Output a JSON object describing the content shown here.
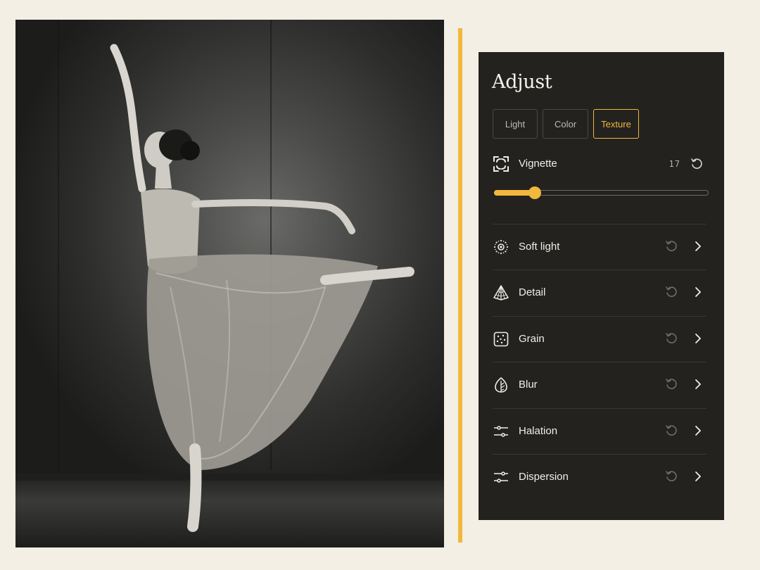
{
  "panel": {
    "title": "Adjust",
    "tabs": [
      {
        "label": "Light",
        "active": false
      },
      {
        "label": "Color",
        "active": false
      },
      {
        "label": "Texture",
        "active": true
      }
    ],
    "vignette": {
      "label": "Vignette",
      "value": "17",
      "slider_fraction": 0.19,
      "icon": "vignette-frame-icon"
    },
    "items": [
      {
        "label": "Soft light",
        "icon": "soft-light-icon"
      },
      {
        "label": "Detail",
        "icon": "detail-pyramid-icon"
      },
      {
        "label": "Grain",
        "icon": "grain-icon"
      },
      {
        "label": "Blur",
        "icon": "blur-leaf-icon"
      },
      {
        "label": "Halation",
        "icon": "sliders-icon"
      },
      {
        "label": "Dispersion",
        "icon": "sliders-icon"
      }
    ]
  },
  "colors": {
    "accent": "#f2b73c",
    "panel_bg": "#23221f",
    "page_bg": "#f3efe4"
  }
}
